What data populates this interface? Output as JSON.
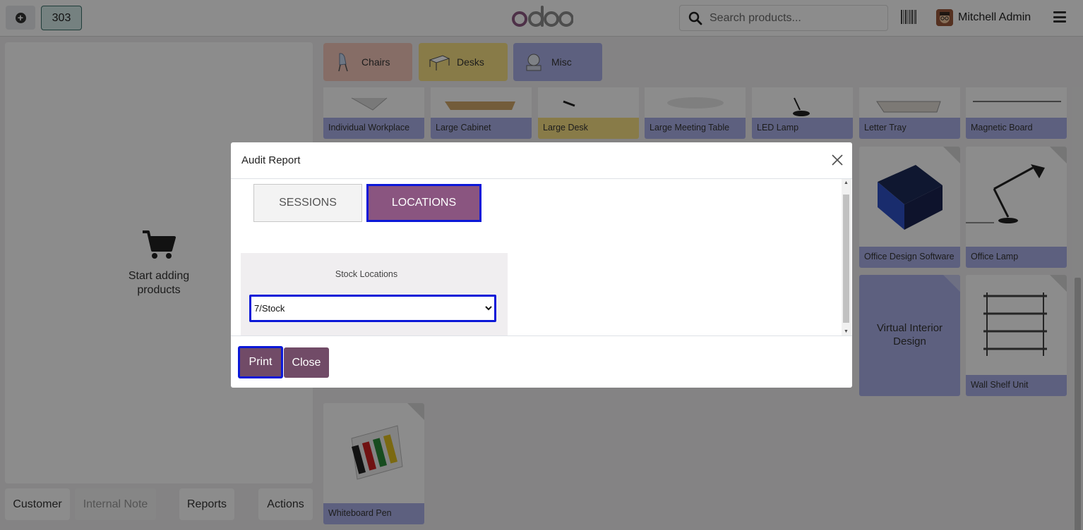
{
  "topbar": {
    "order_number": "303",
    "logo_text": "odoo",
    "search_placeholder": "Search products...",
    "user_name": "Mitchell Admin"
  },
  "cart": {
    "empty_text_line1": "Start adding",
    "empty_text_line2": "products"
  },
  "bottom_buttons": {
    "customer": "Customer",
    "internal_note": "Internal Note",
    "reports": "Reports",
    "actions": "Actions"
  },
  "categories": [
    {
      "label": "Chairs",
      "color": "#f4c7bb"
    },
    {
      "label": "Desks",
      "color": "#f8e084"
    },
    {
      "label": "Misc",
      "color": "#aab0e8"
    }
  ],
  "products": [
    {
      "name": "Individual Workplace",
      "color": "#aab0e8"
    },
    {
      "name": "Large Cabinet",
      "color": "#aab0e8"
    },
    {
      "name": "Large Desk",
      "color": "#f8e084"
    },
    {
      "name": "Large Meeting Table",
      "color": "#aab0e8"
    },
    {
      "name": "LED Lamp",
      "color": "#aab0e8"
    },
    {
      "name": "Letter Tray",
      "color": "#aab0e8"
    },
    {
      "name": "Magnetic Board",
      "color": "#aab0e8"
    },
    {
      "name": "Office Design Software",
      "color": "#aab0e8"
    },
    {
      "name": "Office Lamp",
      "color": "#aab0e8"
    },
    {
      "name": "Virtual Interior Design",
      "color": "#aab0e8"
    },
    {
      "name": "Wall Shelf Unit",
      "color": "#aab0e8"
    },
    {
      "name": "Whiteboard Pen",
      "color": "#aab0e8"
    }
  ],
  "modal": {
    "title": "Audit Report",
    "tab_sessions": "SESSIONS",
    "tab_locations": "LOCATIONS",
    "active_tab": "LOCATIONS",
    "stock_locations_label": "Stock Locations",
    "stock_location_selected": "7/Stock",
    "print_label": "Print",
    "close_label": "Close"
  },
  "colors": {
    "accent": "#714b67",
    "focus_outline": "#0b18d8"
  }
}
